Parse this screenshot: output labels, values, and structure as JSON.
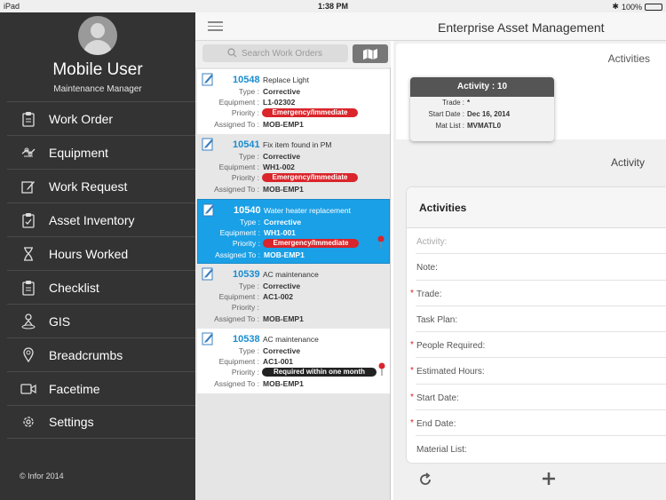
{
  "status_bar": {
    "device": "iPad",
    "time": "1:38 PM",
    "battery": "100%"
  },
  "user": {
    "name": "Mobile User",
    "role": "Maintenance Manager"
  },
  "nav": {
    "items": [
      {
        "label": "Work Order",
        "icon": "clipboard-icon"
      },
      {
        "label": "Equipment",
        "icon": "equipment-icon"
      },
      {
        "label": "Work Request",
        "icon": "edit-icon"
      },
      {
        "label": "Asset Inventory",
        "icon": "inventory-icon"
      },
      {
        "label": "Hours Worked",
        "icon": "hourglass-icon"
      },
      {
        "label": "Checklist",
        "icon": "checklist-icon"
      },
      {
        "label": "GIS",
        "icon": "gis-person-icon"
      },
      {
        "label": "Breadcrumbs",
        "icon": "location-pin-icon"
      },
      {
        "label": "Facetime",
        "icon": "video-camera-icon"
      },
      {
        "label": "Settings",
        "icon": "gear-icon"
      }
    ]
  },
  "copyright": "© Infor 2014",
  "header": {
    "title": "Enterprise Asset Management"
  },
  "search": {
    "placeholder": "Search Work Orders"
  },
  "field_labels": {
    "type": "Type :",
    "equipment": "Equipment :",
    "priority": "Priority :",
    "assigned": "Assigned To :"
  },
  "work_orders": [
    {
      "number": "10548",
      "description": "Replace Light",
      "type": "Corrective",
      "equipment": "L1-02302",
      "priority": "Emergency/Immediate",
      "assigned": "MOB-EMP1"
    },
    {
      "number": "10541",
      "description": "Fix item found in PM",
      "type": "Corrective",
      "equipment": "WH1-002",
      "priority": "Emergency/Immediate",
      "assigned": "MOB-EMP1"
    },
    {
      "number": "10540",
      "description": "Water heater replacement",
      "type": "Corrective",
      "equipment": "WH1-001",
      "priority": "Emergency/Immediate",
      "assigned": "MOB-EMP1"
    },
    {
      "number": "10539",
      "description": "AC maintenance",
      "type": "Corrective",
      "equipment": "AC1-002",
      "priority": "",
      "assigned": "MOB-EMP1"
    },
    {
      "number": "10538",
      "description": "AC maintenance",
      "type": "Corrective",
      "equipment": "AC1-001",
      "priority": "Required within one month",
      "assigned": "MOB-EMP1"
    }
  ],
  "detail": {
    "tab_label": "Activities",
    "card": {
      "title": "Activity :  10",
      "trade_label": "Trade :",
      "trade_value": "*",
      "start_label": "Start Date :",
      "start_value": "Dec 16, 2014",
      "mat_label": "Mat List :",
      "mat_value": "MVMATL0"
    },
    "section_label": "Activity",
    "form_title": "Activities",
    "form_fields": [
      {
        "label": "Activity:",
        "required": false,
        "placeholder": true
      },
      {
        "label": "Note:",
        "required": false,
        "placeholder": false
      },
      {
        "label": "Trade:",
        "required": true,
        "placeholder": false
      },
      {
        "label": "Task Plan:",
        "required": false,
        "placeholder": false
      },
      {
        "label": "People Required:",
        "required": true,
        "placeholder": false
      },
      {
        "label": "Estimated Hours:",
        "required": true,
        "placeholder": false
      },
      {
        "label": "Start Date:",
        "required": true,
        "placeholder": false
      },
      {
        "label": "End Date:",
        "required": true,
        "placeholder": false
      },
      {
        "label": "Material List:",
        "required": false,
        "placeholder": false
      }
    ],
    "required_mark": "*"
  },
  "colors": {
    "sidebar": "#333333",
    "selected": "#1aa0e6",
    "priority_red": "#d9252b",
    "accent_blue": "#1a8dd0"
  }
}
